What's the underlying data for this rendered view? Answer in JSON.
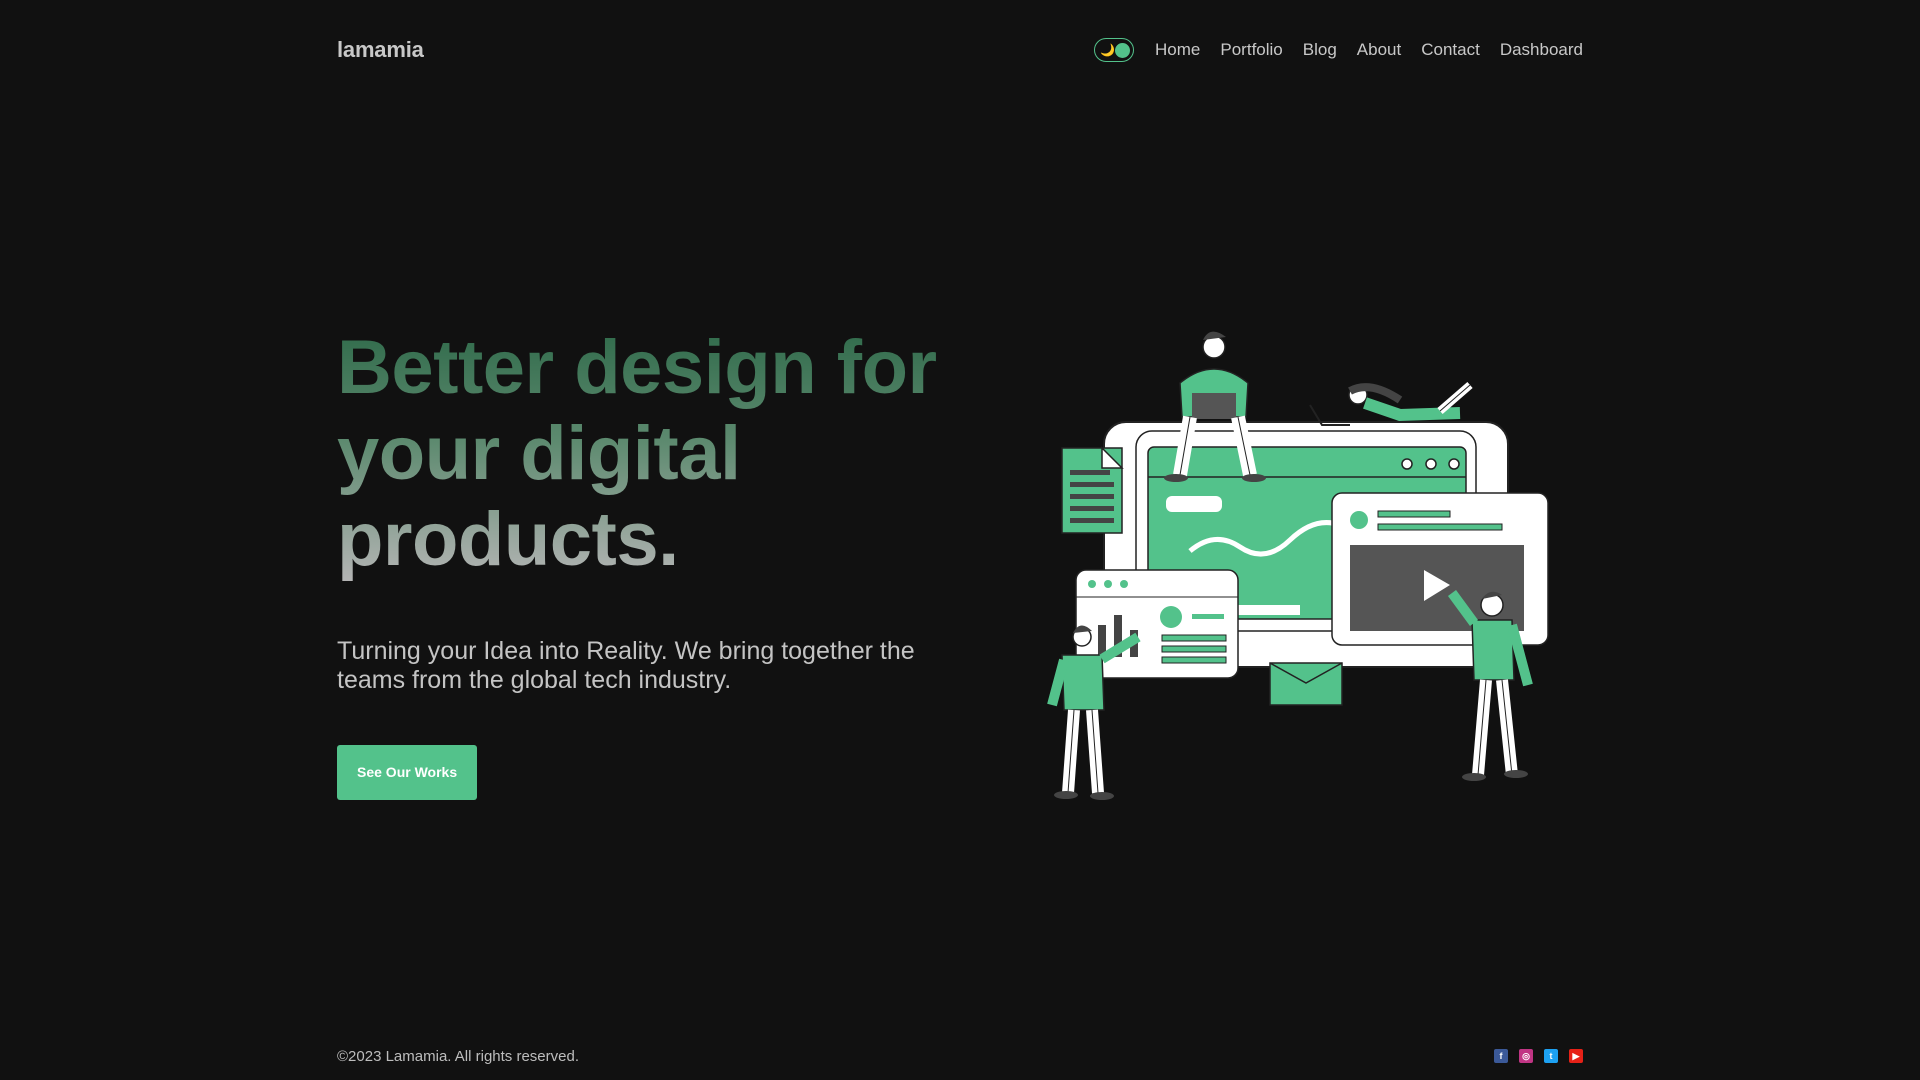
{
  "brand": {
    "logo": "lamamia"
  },
  "nav": {
    "theme_toggle": {
      "moon_glyph": "🌙",
      "icon": "moon-icon"
    },
    "links": [
      "Home",
      "Portfolio",
      "Blog",
      "About",
      "Contact",
      "Dashboard"
    ]
  },
  "hero": {
    "title": "Better design for your digital products.",
    "description": "Turning your Idea into Reality. We bring together the teams from the global tech industry.",
    "button_label": "See Our Works",
    "illustration": "team-digital-products-illustration"
  },
  "footer": {
    "copyright": "©2023 Lamamia. All rights reserved.",
    "socials": [
      {
        "name": "facebook",
        "glyph": "f",
        "color": "#3b5998"
      },
      {
        "name": "instagram",
        "glyph": "◎",
        "color": "#c13584"
      },
      {
        "name": "twitter",
        "glyph": "t",
        "color": "#1da1f2"
      },
      {
        "name": "youtube",
        "glyph": "▶",
        "color": "#e62117"
      }
    ]
  },
  "colors": {
    "background": "#111111",
    "accent": "#53c28b",
    "text": "#bbbbbb"
  }
}
